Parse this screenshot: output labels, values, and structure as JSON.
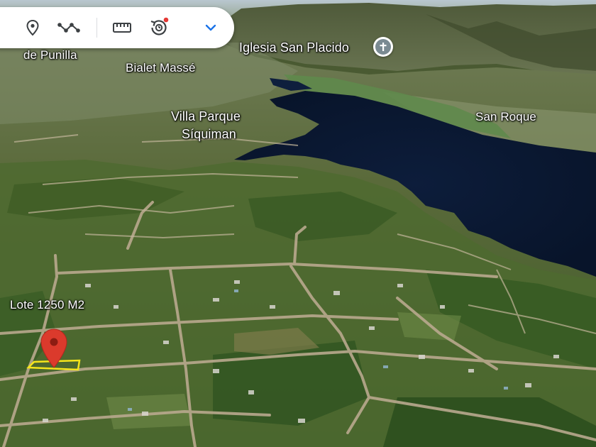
{
  "toolbar": {
    "tools": [
      {
        "name": "location-pin",
        "label": "Add placemark"
      },
      {
        "name": "path",
        "label": "Draw line or shape"
      },
      {
        "name": "ruler",
        "label": "Measure distance and area"
      },
      {
        "name": "history",
        "label": "Historical imagery"
      },
      {
        "name": "more",
        "label": "More"
      }
    ],
    "notification_color": "#e53935"
  },
  "map": {
    "labels": {
      "punilla": "de Punilla",
      "iglesia": "Iglesia San Placido",
      "bialet": "Bialet Massé",
      "villa_line1": "Villa Parque",
      "villa_line2": "Síquiman",
      "san_roque": "San Roque",
      "lote": "Lote 1250 M2"
    },
    "marker_color": "#db3a2c",
    "lot_outline_color": "#f5e51b",
    "lake_color": "#0b1a36"
  }
}
